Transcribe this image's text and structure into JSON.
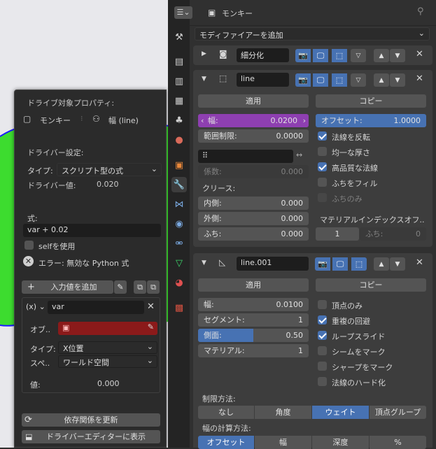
{
  "header": {
    "object_name": "モンキー"
  },
  "add_modifier": "モディファイアーを追加",
  "mod1": {
    "name": "細分化"
  },
  "mod2": {
    "name": "line",
    "apply": "適用",
    "copy": "コピー",
    "width_label": "幅:",
    "width_value": "0.0200",
    "offset_label": "オフセット:",
    "offset_value": "1.0000",
    "clamp_label": "範囲制限:",
    "clamp_value": "0.0000",
    "factor_label": "係数:",
    "factor_value": "0.000",
    "flip_normals": "法線を反転",
    "even_thickness": "均一な厚さ",
    "hq_normals": "高品質な法線",
    "fill_rim": "ふちをフィル",
    "rim_only": "ふちのみ",
    "crease_label": "クリース:",
    "inner_label": "内側:",
    "inner_value": "0.000",
    "outer_label": "外側:",
    "outer_value": "0.000",
    "rim_label": "ふち:",
    "rim_value": "0.000",
    "mat_index_label": "マテリアルインデックスオフ..",
    "mat_index_value": "1",
    "mat_rim_label": "ふち:",
    "mat_rim_value": "0"
  },
  "mod3": {
    "name": "line.001",
    "apply": "適用",
    "copy": "コピー",
    "width_label": "幅:",
    "width_value": "0.0100",
    "segments_label": "セグメント:",
    "segments_value": "1",
    "side_label": "側面:",
    "side_value": "0.50",
    "side_fraction": 0.5,
    "material_label": "マテリアル:",
    "material_value": "1",
    "vertex_only": "頂点のみ",
    "merge_dups": "重複の回避",
    "loop_slide": "ループスライド",
    "mark_seam": "シームをマーク",
    "mark_sharp": "シャープをマーク",
    "harden_normals": "法線のハード化",
    "limit_label": "制限方法:",
    "limit_options": [
      "なし",
      "角度",
      "ウェイト",
      "頂点グループ"
    ],
    "width_method_label": "幅の計算方法:",
    "width_method_options": [
      "オフセット",
      "幅",
      "深度",
      "%"
    ]
  },
  "driver": {
    "target_label": "ドライブ対象プロパティ:",
    "target_object": "モンキー",
    "target_prop": "幅 (line)",
    "settings_label": "ドライバー設定:",
    "type_label": "タイプ:",
    "type_value": "スクリプト型の式",
    "value_label": "ドライバー値:",
    "value": "0.020",
    "expr_label": "式:",
    "expr": "var + 0.02",
    "use_self": "selfを使用",
    "error": "エラー: 無効な Python 式",
    "add_input": "入力値を追加",
    "var_type": "(x)",
    "var_name": "var",
    "obj_label": "オブ..",
    "vtype_label": "タイプ:",
    "vtype_value": "X位置",
    "space_label": "スペ..",
    "space_value": "ワールド空間",
    "var_value_label": "値:",
    "var_value": "0.000",
    "update_deps": "依存関係を更新",
    "show_editor": "ドライバーエディターに表示"
  }
}
